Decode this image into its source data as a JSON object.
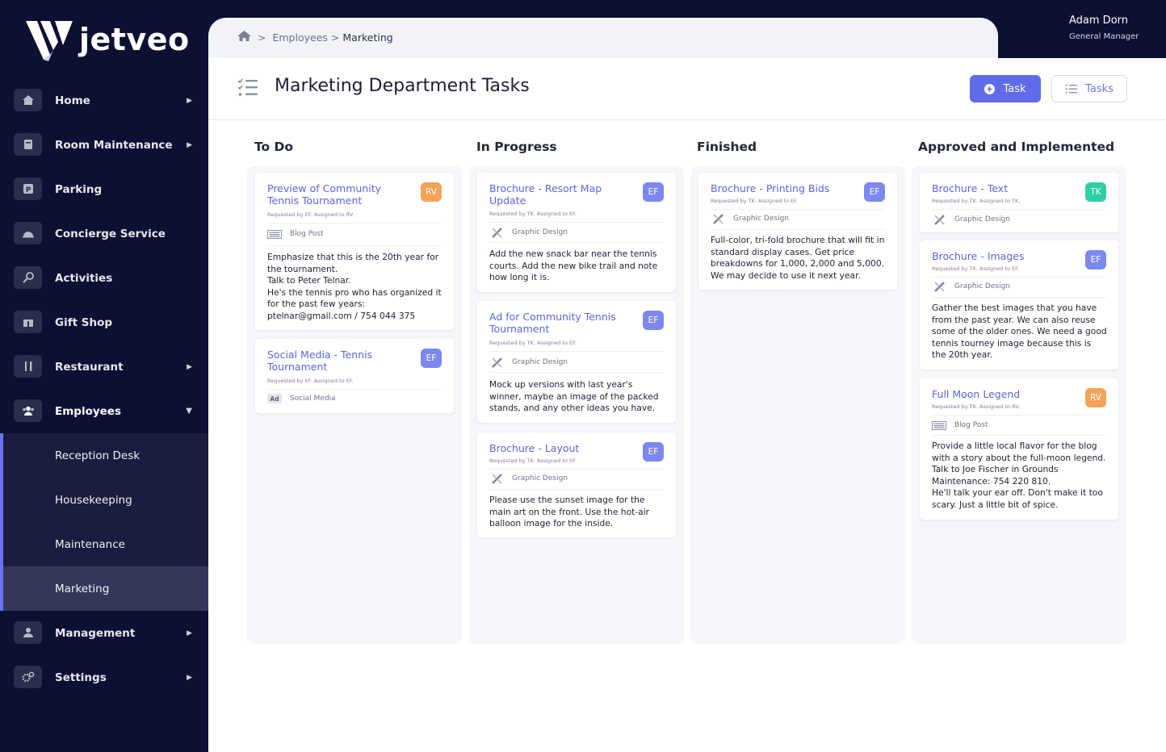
{
  "brand": {
    "name": "jetveo"
  },
  "user": {
    "name": "Adam Dorn",
    "role": "General Manager"
  },
  "sidebar": {
    "items": [
      {
        "label": "Home",
        "icon": "home-icon",
        "arrow": "right"
      },
      {
        "label": "Room Maintenance",
        "icon": "book-icon",
        "arrow": "right"
      },
      {
        "label": "Parking",
        "icon": "parking-icon",
        "arrow": ""
      },
      {
        "label": "Concierge Service",
        "icon": "bell-icon",
        "arrow": ""
      },
      {
        "label": "Activities",
        "icon": "racket-icon",
        "arrow": ""
      },
      {
        "label": "Gift Shop",
        "icon": "gift-icon",
        "arrow": ""
      },
      {
        "label": "Restaurant",
        "icon": "cutlery-icon",
        "arrow": "right"
      },
      {
        "label": "Employees",
        "icon": "users-icon",
        "arrow": "down"
      },
      {
        "label": "Reception Desk",
        "sub": true
      },
      {
        "label": "Housekeeping",
        "sub": true
      },
      {
        "label": "Maintenance",
        "sub": true
      },
      {
        "label": "Marketing",
        "sub": true,
        "active": true
      },
      {
        "label": "Management",
        "icon": "manager-icon",
        "arrow": "right"
      },
      {
        "label": "Settings",
        "icon": "gears-icon",
        "arrow": "right"
      }
    ]
  },
  "breadcrumb": {
    "sep": ">",
    "parent": "Employees",
    "current": "Marketing"
  },
  "page": {
    "title": "Marketing Department Tasks",
    "add_task_label": "Task",
    "tasks_label": "Tasks"
  },
  "board": {
    "columns": [
      {
        "title": "To Do",
        "cards": [
          {
            "title": "Preview of Community Tennis Tournament",
            "badge": "RV",
            "badge_color": "#f5a358",
            "meta": "Requested by EF. Assigned to RV.",
            "category": "Blog Post",
            "category_icon": "newspaper-icon",
            "body": "Emphasize that this is the 20th year for the tournament.\nTalk to Peter Telnar.\nHe's the tennis pro who has organized it for the past few years:\nptelnar@gmail.com / 754 044 375"
          },
          {
            "title": "Social Media - Tennis Tournament",
            "badge": "EF",
            "badge_color": "#7c87ef",
            "meta": "Requested by EF. Assigned to EF.",
            "category": "Social Media",
            "category_icon": "ad-icon",
            "category_icon_text": "Ad",
            "body": ""
          }
        ]
      },
      {
        "title": "In Progress",
        "cards": [
          {
            "title": "Brochure - Resort Map Update",
            "badge": "EF",
            "badge_color": "#7c87ef",
            "meta": "Requested by TK. Assigned to EF.",
            "category": "Graphic Design",
            "category_icon": "design-tools-icon",
            "body": "Add the new snack bar near the tennis courts. Add the new bike trail and note how long it is."
          },
          {
            "title": "Ad for Community Tennis Tournament",
            "badge": "EF",
            "badge_color": "#7c87ef",
            "meta": "Requested by TK. Assigned to EF.",
            "category": "Graphic Design",
            "category_icon": "design-tools-icon",
            "body": "Mock up versions with last year's winner, maybe an image of the packed stands, and any other ideas you have."
          },
          {
            "title": "Brochure - Layout",
            "badge": "EF",
            "badge_color": "#7c87ef",
            "meta": "Requested by TK. Assigned to EF.",
            "category": "Graphic Design",
            "category_icon": "design-tools-icon",
            "body": "Please use the sunset image for the main art on the front. Use the hot-air balloon image for the inside."
          }
        ]
      },
      {
        "title": "Finished",
        "cards": [
          {
            "title": "Brochure - Printing Bids",
            "badge": "EF",
            "badge_color": "#7c87ef",
            "meta": "Requested by TK. Assigned to EF.",
            "category": "Graphic Design",
            "category_icon": "design-tools-icon",
            "body": "Full-color, tri-fold brochure that will fit in standard display cases. Get price breakdowns for 1,000, 2,000 and 5,000. We may decide to use it next year."
          }
        ]
      },
      {
        "title": "Approved and Implemented",
        "cards": [
          {
            "title": "Brochure - Text",
            "badge": "TK",
            "badge_color": "#2fcfa6",
            "meta": "Requested by TK. Assigned to TK.",
            "category": "Graphic Design",
            "category_icon": "design-tools-icon",
            "body": ""
          },
          {
            "title": "Brochure - Images",
            "badge": "EF",
            "badge_color": "#7c87ef",
            "meta": "Requested by TK. Assigned to EF.",
            "category": "Graphic Design",
            "category_icon": "design-tools-icon",
            "body": "Gather the best images that you have from the past year. We can also reuse some of the older ones. We need a good tennis tourney image because this is the 20th year."
          },
          {
            "title": "Full Moon Legend",
            "badge": "RV",
            "badge_color": "#f5a358",
            "meta": "Requested by TK. Assigned to RV.",
            "category": "Blog Post",
            "category_icon": "newspaper-icon",
            "body": "Provide a little local flavor for the blog with a story about the full-moon legend.\nTalk to Joe Fischer in Grounds Maintenance: 754 220 810.\nHe'll talk your ear off. Don't make it too scary. Just a little bit of spice."
          }
        ]
      }
    ]
  }
}
